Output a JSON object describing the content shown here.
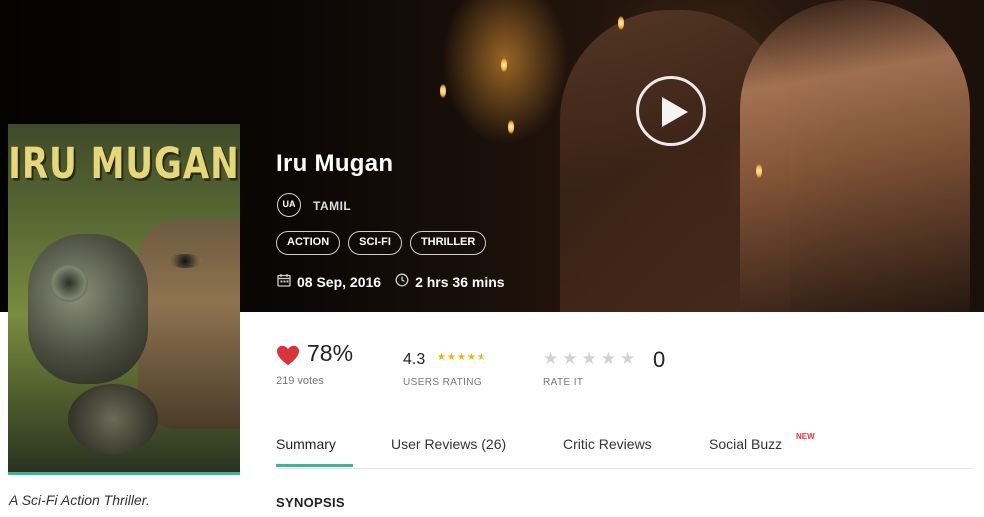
{
  "movie": {
    "title": "Iru Mugan",
    "poster_title": "IRU MUGAN",
    "certificate": "UA",
    "language": "TAMIL",
    "genres": [
      "ACTION",
      "SCI-FI",
      "THRILLER"
    ],
    "release_date": "08 Sep, 2016",
    "duration": "2 hrs 36 mins",
    "tagline": "A Sci-Fi Action Thriller."
  },
  "ratings": {
    "like_percent": "78%",
    "votes": "219 votes",
    "users_rating": "4.3",
    "users_rating_stars": 4.3,
    "users_rating_label": "USERS RATING",
    "rate_it_count": "0",
    "rate_it_label": "RATE IT"
  },
  "tabs": [
    {
      "label": "Summary",
      "active": true
    },
    {
      "label": "User Reviews (26)",
      "active": false
    },
    {
      "label": "Critic Reviews",
      "active": false
    },
    {
      "label": "Social Buzz",
      "active": false
    }
  ],
  "new_badge": "NEW",
  "synopsis_heading": "SYNOPSIS",
  "colors": {
    "accent": "#3cb497",
    "heart": "#d9343a",
    "star": "#f5b400",
    "new_badge": "#e33333"
  },
  "icons": [
    "play-icon",
    "heart-icon",
    "star-icon",
    "calendar-icon",
    "clock-icon"
  ]
}
